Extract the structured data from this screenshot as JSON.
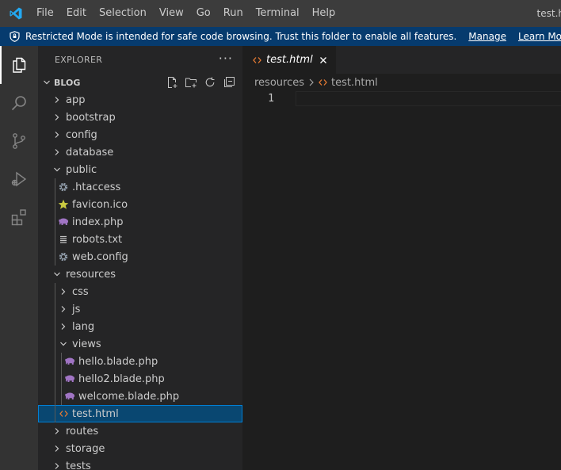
{
  "titlebar": {
    "menu": [
      "File",
      "Edit",
      "Selection",
      "View",
      "Go",
      "Run",
      "Terminal",
      "Help"
    ],
    "window_title": "test.h"
  },
  "banner": {
    "message": "Restricted Mode is intended for safe code browsing. Trust this folder to enable all features.",
    "manage_label": "Manage",
    "learn_more_label": "Learn More"
  },
  "activity_bar": [
    "explorer-icon",
    "search-icon",
    "source-control-icon",
    "run-debug-icon",
    "extensions-icon"
  ],
  "sidebar": {
    "title": "EXPLORER",
    "more": "···",
    "section_title": "BLOG",
    "tree": [
      {
        "label": "app",
        "depth": 0,
        "type": "folder",
        "expanded": false
      },
      {
        "label": "bootstrap",
        "depth": 0,
        "type": "folder",
        "expanded": false
      },
      {
        "label": "config",
        "depth": 0,
        "type": "folder",
        "expanded": false
      },
      {
        "label": "database",
        "depth": 0,
        "type": "folder",
        "expanded": false
      },
      {
        "label": "public",
        "depth": 0,
        "type": "folder",
        "expanded": true
      },
      {
        "label": ".htaccess",
        "depth": 1,
        "type": "file",
        "icon": "gear"
      },
      {
        "label": "favicon.ico",
        "depth": 1,
        "type": "file",
        "icon": "star"
      },
      {
        "label": "index.php",
        "depth": 1,
        "type": "file",
        "icon": "php"
      },
      {
        "label": "robots.txt",
        "depth": 1,
        "type": "file",
        "icon": "lines"
      },
      {
        "label": "web.config",
        "depth": 1,
        "type": "file",
        "icon": "gear"
      },
      {
        "label": "resources",
        "depth": 0,
        "type": "folder",
        "expanded": true
      },
      {
        "label": "css",
        "depth": 1,
        "type": "folder",
        "expanded": false
      },
      {
        "label": "js",
        "depth": 1,
        "type": "folder",
        "expanded": false
      },
      {
        "label": "lang",
        "depth": 1,
        "type": "folder",
        "expanded": false
      },
      {
        "label": "views",
        "depth": 1,
        "type": "folder",
        "expanded": true
      },
      {
        "label": "hello.blade.php",
        "depth": 2,
        "type": "file",
        "icon": "php"
      },
      {
        "label": "hello2.blade.php",
        "depth": 2,
        "type": "file",
        "icon": "php"
      },
      {
        "label": "welcome.blade.php",
        "depth": 2,
        "type": "file",
        "icon": "php"
      },
      {
        "label": "test.html",
        "depth": 1,
        "type": "file",
        "icon": "html",
        "selected": true
      },
      {
        "label": "routes",
        "depth": 0,
        "type": "folder",
        "expanded": false
      },
      {
        "label": "storage",
        "depth": 0,
        "type": "folder",
        "expanded": false
      },
      {
        "label": "tests",
        "depth": 0,
        "type": "folder",
        "expanded": false
      }
    ]
  },
  "editor": {
    "tab_label": "test.html",
    "breadcrumb": [
      "resources",
      "test.html"
    ],
    "line_number": "1"
  },
  "colors": {
    "accent": "#007acc",
    "html_icon": "#e37933",
    "php_icon": "#a074c4",
    "star_icon": "#cbcb41",
    "banner_bg": "#063b6e"
  }
}
